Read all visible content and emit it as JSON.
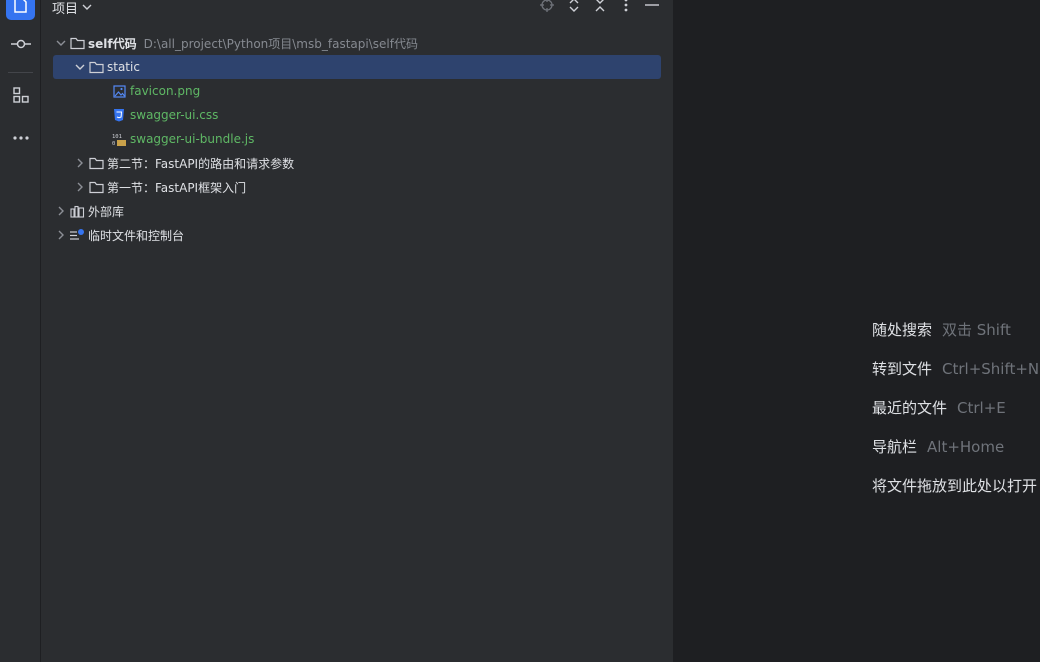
{
  "toolbar": {
    "items": [
      {
        "name": "project",
        "icon": "folder-icon"
      },
      {
        "name": "commit",
        "icon": "commit-icon"
      },
      {
        "name": "structure",
        "icon": "structure-icon"
      },
      {
        "name": "more",
        "icon": "more-icon"
      }
    ]
  },
  "panel": {
    "title": "项目"
  },
  "tree": {
    "root": {
      "label": "self代码",
      "path": "D:\\all_project\\Python项目\\msb_fastapi\\self代码"
    },
    "static": {
      "label": "static"
    },
    "files": [
      {
        "label": "favicon.png",
        "icon": "image-file-icon"
      },
      {
        "label": "swagger-ui.css",
        "icon": "css-file-icon"
      },
      {
        "label": "swagger-ui-bundle.js",
        "icon": "js-file-icon"
      }
    ],
    "folders": [
      {
        "label": "第二节：FastAPI的路由和请求参数"
      },
      {
        "label": "第一节：FastAPI框架入门"
      }
    ],
    "external_libs": {
      "label": "外部库"
    },
    "scratches": {
      "label": "临时文件和控制台"
    }
  },
  "editor_hints": [
    {
      "action": "随处搜索",
      "shortcut": "双击 Shift"
    },
    {
      "action": "转到文件",
      "shortcut": "Ctrl+Shift+N"
    },
    {
      "action": "最近的文件",
      "shortcut": "Ctrl+E"
    },
    {
      "action": "导航栏",
      "shortcut": "Alt+Home"
    },
    {
      "action": "将文件拖放到此处以打开",
      "shortcut": ""
    }
  ],
  "colors": {
    "accent": "#3574f0",
    "selection": "#2e436e",
    "file_green": "#5fb865"
  }
}
